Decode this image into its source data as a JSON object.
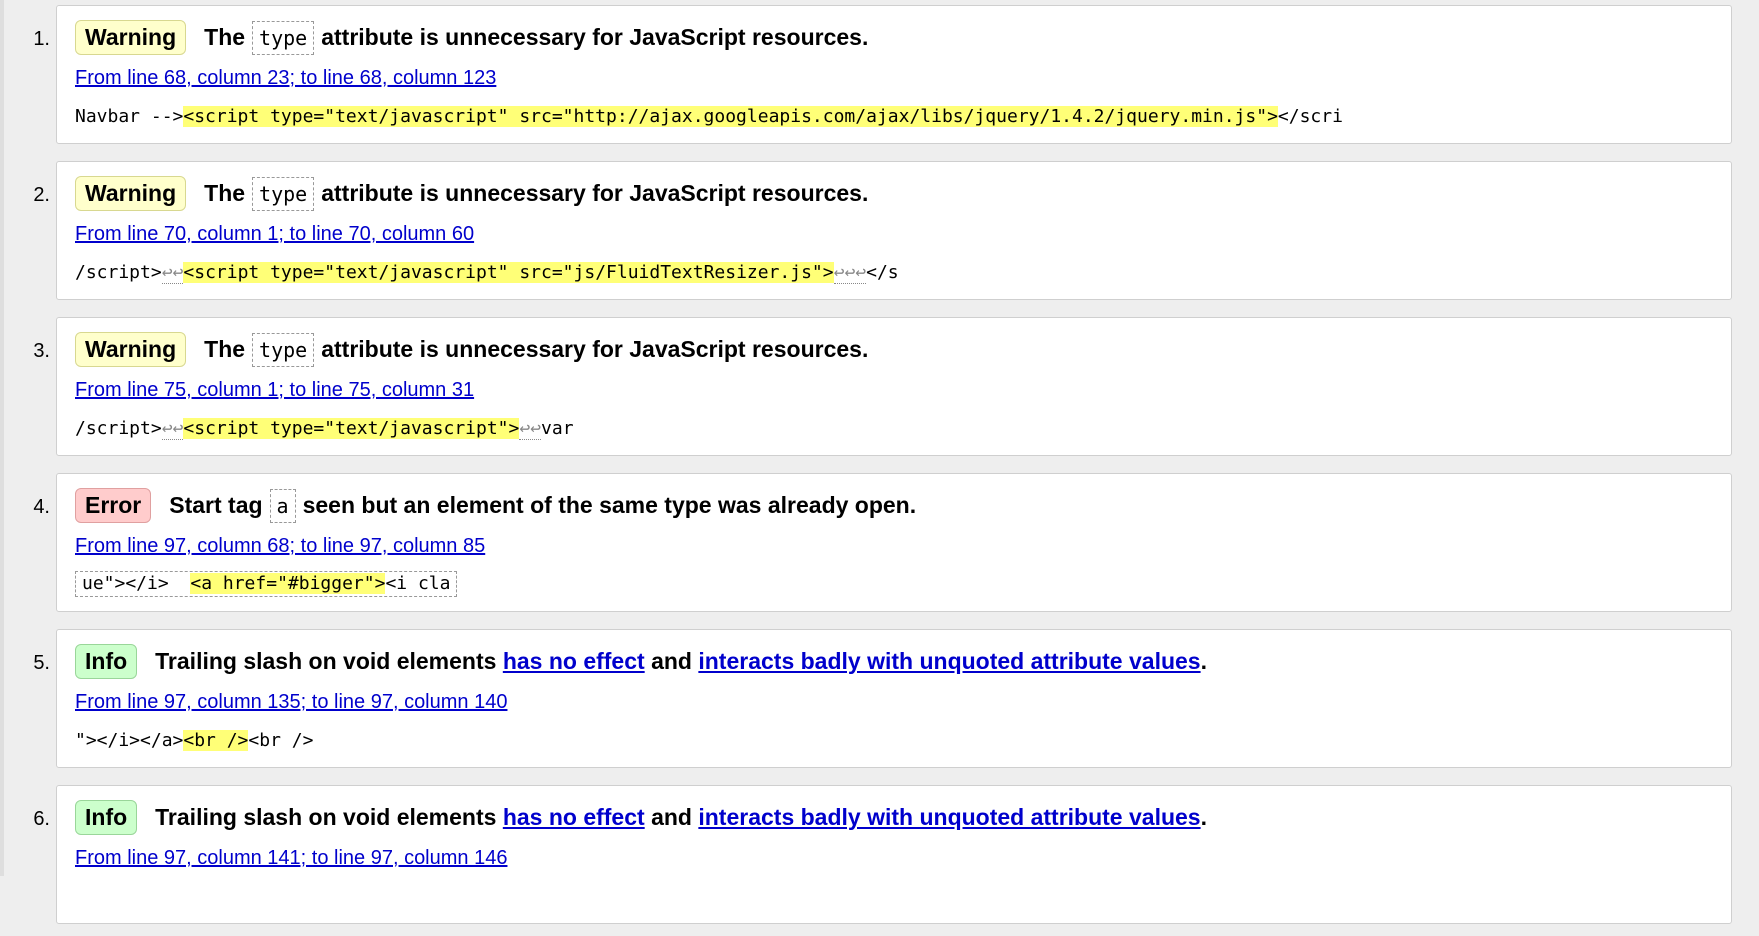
{
  "messages": [
    {
      "number": "1.",
      "type": "Warning",
      "msg_before": "The",
      "msg_code": "type",
      "msg_after": "attribute is unnecessary for JavaScript resources.",
      "location": "From line 68, column 23; to line 68, column 123",
      "extract_before": "Navbar -->",
      "extract_highlight": "<script type=\"text/javascript\" src=\"http://ajax.googleapis.com/ajax/libs/jquery/1.4.2/jquery.min.js\">",
      "extract_after": "</scri"
    },
    {
      "number": "2.",
      "type": "Warning",
      "msg_before": "The",
      "msg_code": "type",
      "msg_after": "attribute is unnecessary for JavaScript resources.",
      "location": "From line 70, column 1; to line 70, column 60",
      "extract_before": "/script>",
      "extract_lf_before": "↩↩",
      "extract_highlight": "<script type=\"text/javascript\" src=\"js/FluidTextResizer.js\">",
      "extract_lf_after": "↩↩↩",
      "extract_after": "</s"
    },
    {
      "number": "3.",
      "type": "Warning",
      "msg_before": "The",
      "msg_code": "type",
      "msg_after": "attribute is unnecessary for JavaScript resources.",
      "location": "From line 75, column 1; to line 75, column 31",
      "extract_before": "/script>",
      "extract_lf_before": "↩↩",
      "extract_highlight": "<script type=\"text/javascript\">",
      "extract_lf_after": "↩↩",
      "extract_after": "var"
    },
    {
      "number": "4.",
      "type": "Error",
      "msg_before": "Start tag",
      "msg_code": "a",
      "msg_after": "seen but an element of the same type was already open.",
      "location": "From line 97, column 68; to line 97, column 85",
      "extract_before": "ue\"></i>  ",
      "extract_highlight": "<a href=\"#bigger\">",
      "extract_after": "<i cla"
    },
    {
      "number": "5.",
      "type": "Info",
      "msg_before": "Trailing slash on void elements",
      "link1": "has no effect",
      "msg_mid": "and",
      "link2": "interacts badly with unquoted attribute values",
      "msg_end": ".",
      "location": "From line 97, column 135; to line 97, column 140",
      "extract_before": "\"></i></a>",
      "extract_highlight": "<br />",
      "extract_after": "<br />"
    },
    {
      "number": "6.",
      "type": "Info",
      "msg_before": "Trailing slash on void elements",
      "link1": "has no effect",
      "msg_mid": "and",
      "link2": "interacts badly with unquoted attribute values",
      "msg_end": ".",
      "location": "From line 97, column 141; to line 97, column 146"
    }
  ]
}
